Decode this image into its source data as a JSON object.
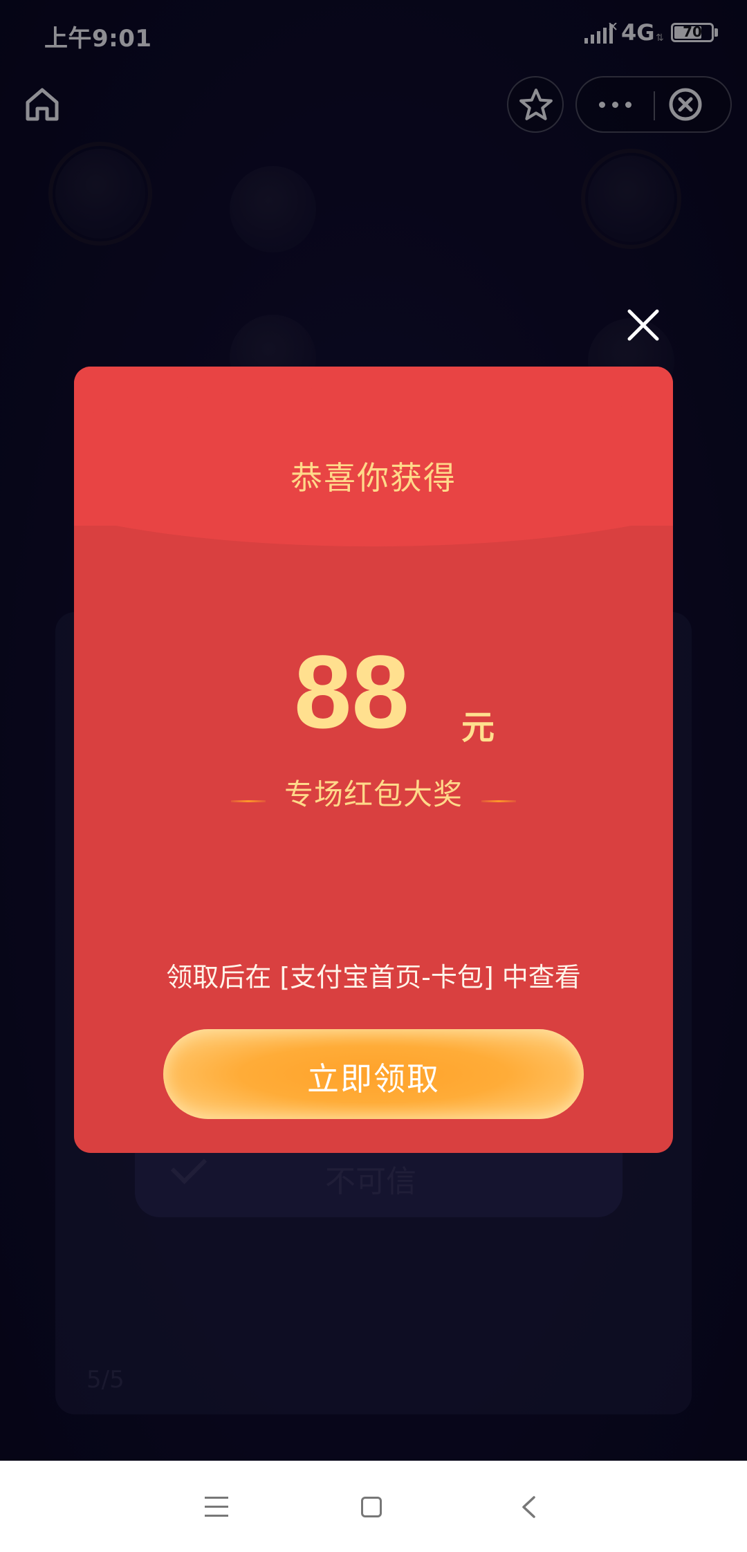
{
  "status_bar": {
    "time": "上午9:01",
    "network": "4G",
    "battery_level": "70"
  },
  "nav": {
    "home_icon": "home-icon",
    "favorite_icon": "star-icon",
    "more_icon": "more-dots-icon",
    "exit_icon": "close-circle-icon"
  },
  "background": {
    "page_indicator": "5/5",
    "button_label": "不可信"
  },
  "modal": {
    "title": "恭喜你获得",
    "amount": "88",
    "unit": "元",
    "prize_label": "专场红包大奖",
    "hint": "领取后在 [支付宝首页-卡包] 中查看",
    "claim_button": "立即领取",
    "close_icon": "close-icon",
    "colors": {
      "card": "#d94040",
      "card_top": "#e84444",
      "gold_text": "#ffd98a",
      "button": "#ffa22a"
    }
  },
  "system_nav": {
    "menu_icon": "menu-icon",
    "home_icon": "square-icon",
    "back_icon": "back-icon"
  }
}
